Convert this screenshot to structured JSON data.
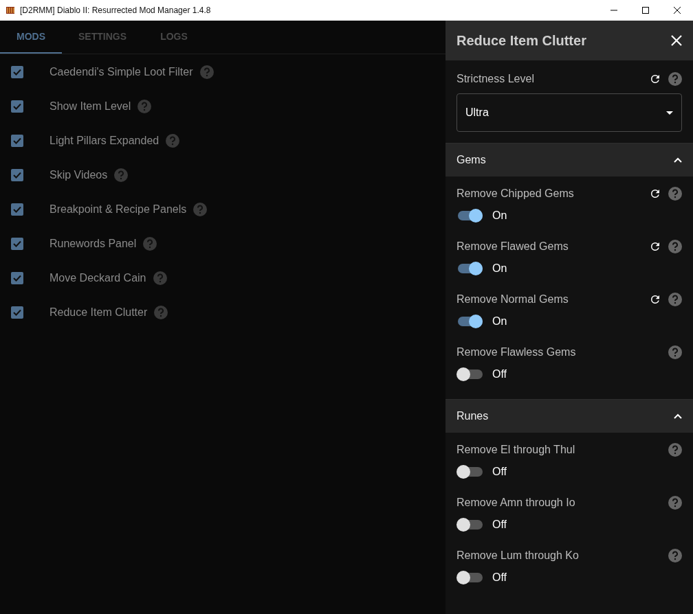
{
  "window": {
    "title": "[D2RMM] Diablo II: Resurrected Mod Manager 1.4.8"
  },
  "tabs": [
    {
      "label": "MODS",
      "selected": true
    },
    {
      "label": "SETTINGS",
      "selected": false
    },
    {
      "label": "LOGS",
      "selected": false
    }
  ],
  "mods": [
    {
      "name": "Caedendi's Simple Loot Filter",
      "checked": true
    },
    {
      "name": "Show Item Level",
      "checked": true
    },
    {
      "name": "Light Pillars Expanded",
      "checked": true
    },
    {
      "name": "Skip Videos",
      "checked": true
    },
    {
      "name": "Breakpoint & Recipe Panels",
      "checked": true
    },
    {
      "name": "Runewords Panel",
      "checked": true
    },
    {
      "name": "Move Deckard Cain",
      "checked": true
    },
    {
      "name": "Reduce Item Clutter",
      "checked": true
    }
  ],
  "panel": {
    "title": "Reduce Item Clutter",
    "strictness": {
      "label": "Strictness Level",
      "value": "Ultra",
      "resettable": true
    },
    "sections": [
      {
        "title": "Gems",
        "expanded": true,
        "items": [
          {
            "label": "Remove Chipped Gems",
            "resettable": true,
            "on": true,
            "state_text": "On"
          },
          {
            "label": "Remove Flawed Gems",
            "resettable": true,
            "on": true,
            "state_text": "On"
          },
          {
            "label": "Remove Normal Gems",
            "resettable": true,
            "on": true,
            "state_text": "On"
          },
          {
            "label": "Remove Flawless Gems",
            "resettable": false,
            "on": false,
            "state_text": "Off"
          }
        ]
      },
      {
        "title": "Runes",
        "expanded": true,
        "items": [
          {
            "label": "Remove El through Thul",
            "resettable": false,
            "on": false,
            "state_text": "Off"
          },
          {
            "label": "Remove Amn through Io",
            "resettable": false,
            "on": false,
            "state_text": "Off"
          },
          {
            "label": "Remove Lum through Ko",
            "resettable": false,
            "on": false,
            "state_text": "Off"
          }
        ]
      }
    ]
  }
}
